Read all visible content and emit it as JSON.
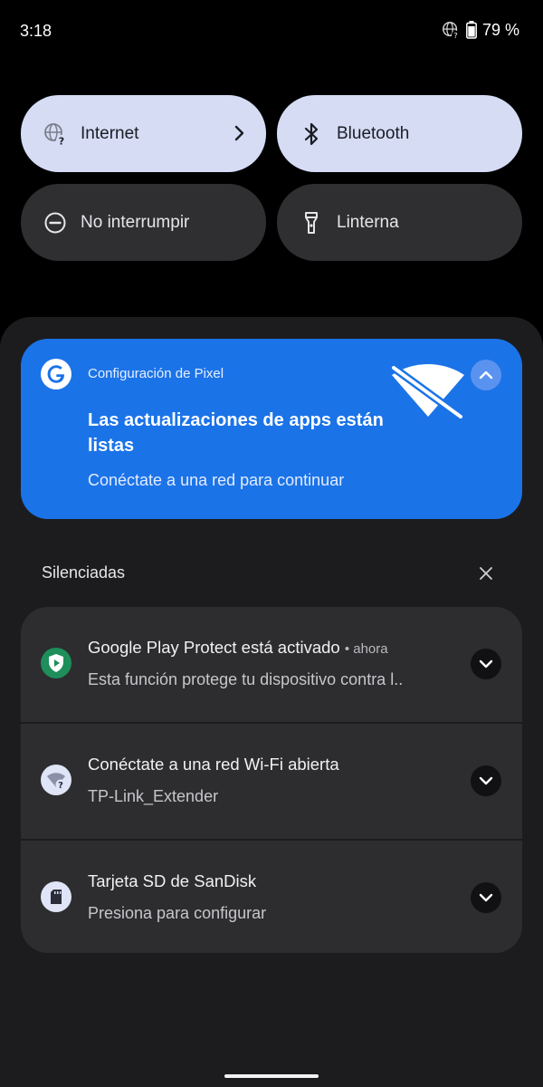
{
  "status_bar": {
    "time": "3:18",
    "battery": "79 %",
    "icons": [
      "globe-question-icon",
      "battery-icon"
    ]
  },
  "quick_tiles": [
    {
      "label": "Internet",
      "state": "on",
      "icon": "globe-question-icon",
      "has_chevron": true
    },
    {
      "label": "Bluetooth",
      "state": "on",
      "icon": "bluetooth-icon"
    },
    {
      "label": "No interrumpir",
      "state": "off",
      "icon": "do-not-disturb-icon"
    },
    {
      "label": "Linterna",
      "state": "off",
      "icon": "flashlight-icon"
    }
  ],
  "promo_notification": {
    "app": "Configuración de Pixel",
    "title": "Las actualizaciones de apps están listas",
    "text": "Conéctate a una red para continuar",
    "icon": "google-g-icon",
    "illustration": "wifi-off-icon",
    "color": "#1b73e8"
  },
  "silent_section": {
    "label": "Silenciadas",
    "notifications": [
      {
        "title": "Google Play Protect está activado",
        "time": "• ahora",
        "text": "Esta función protege tu dispositivo contra l..",
        "icon": "play-protect-icon"
      },
      {
        "title": "Conéctate a una red Wi-Fi abierta",
        "text": "TP-Link_Extender",
        "icon": "wifi-question-icon"
      },
      {
        "title": "Tarjeta SD de SanDisk",
        "text": "Presiona para configurar",
        "icon": "sd-card-icon"
      }
    ]
  },
  "colors": {
    "tile_on": "#d5dcf4",
    "tile_off": "#2f2f31",
    "shade": "#1c1c1e",
    "accent_blue": "#1b73e8",
    "play_protect_green": "#1e8e5a"
  }
}
